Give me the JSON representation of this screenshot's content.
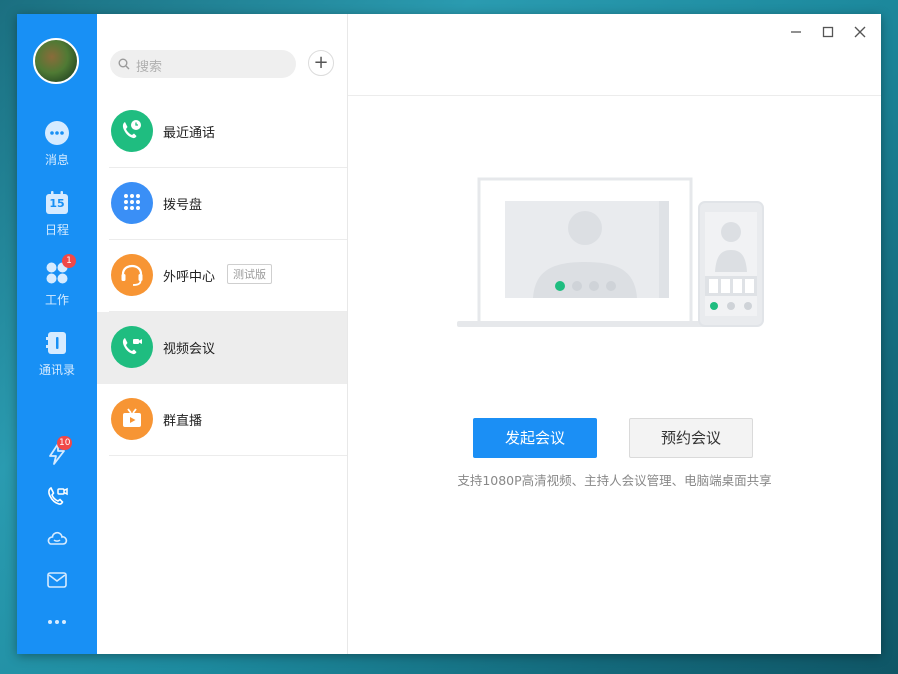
{
  "sidebar": {
    "items": [
      {
        "label": "消息",
        "icon": "chat-icon"
      },
      {
        "label": "日程",
        "icon": "calendar-icon",
        "date": "15"
      },
      {
        "label": "工作",
        "icon": "apps-icon",
        "badge": "1"
      },
      {
        "label": "通讯录",
        "icon": "contacts-icon"
      }
    ],
    "bottom": {
      "flash_badge": "10"
    }
  },
  "search": {
    "placeholder": "搜索"
  },
  "add_label": "+",
  "list": {
    "items": [
      {
        "label": "最近通话",
        "color": "#1fbd80"
      },
      {
        "label": "拨号盘",
        "color": "#3a8ff6"
      },
      {
        "label": "外呼中心",
        "color": "#f79534",
        "tag": "测试版"
      },
      {
        "label": "视频会议",
        "color": "#1fbd80"
      },
      {
        "label": "群直播",
        "color": "#f79534"
      }
    ]
  },
  "main": {
    "start_button": "发起会议",
    "schedule_button": "预约会议",
    "description": "支持1080P高清视频、主持人会议管理、电脑端桌面共享"
  },
  "colors": {
    "accent": "#1890f5"
  }
}
